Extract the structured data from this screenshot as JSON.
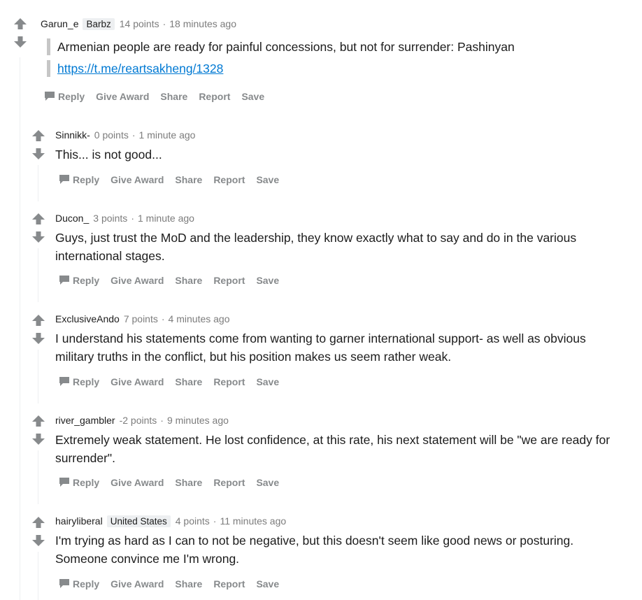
{
  "comments": [
    {
      "author": "Garun_e",
      "flair": "Barbz",
      "points": "14 points",
      "time": "18 minutes ago",
      "quote_lines": [
        "Armenian people are ready for painful concessions, but not for surrender: Pashinyan"
      ],
      "link": "https://t.me/reartsakheng/1328"
    },
    {
      "author": "Sinnikk-",
      "points": "0 points",
      "time": "1 minute ago",
      "text": "This... is not good..."
    },
    {
      "author": "Ducon_",
      "points": "3 points",
      "time": "1 minute ago",
      "text": "Guys, just trust the MoD and the leadership, they know exactly what to say and do in the various international stages."
    },
    {
      "author": "ExclusiveAndo",
      "points": "7 points",
      "time": "4 minutes ago",
      "text": "I understand his statements come from wanting to garner international support- as well as obvious military truths in the conflict, but his position makes us seem rather weak."
    },
    {
      "author": "river_gambler",
      "points": "-2 points",
      "time": "9 minutes ago",
      "text": "Extremely weak statement. He lost confidence, at this rate, his next statement will be \"we are ready for surrender\"."
    },
    {
      "author": "hairyliberal",
      "flair": "United States",
      "points": "4 points",
      "time": "11 minutes ago",
      "text": "I'm trying as hard as I can to not be negative, but this doesn't seem like good news or posturing. Someone convince me I'm wrong."
    }
  ],
  "actions": {
    "reply": "Reply",
    "award": "Give Award",
    "share": "Share",
    "report": "Report",
    "save": "Save"
  },
  "meta_separator": "·",
  "icons": {
    "upvote": "arrow-up-icon",
    "downvote": "arrow-down-icon",
    "reply": "speech-bubble-icon"
  },
  "colors": {
    "link": "#0079d3",
    "action_text": "#878a8c",
    "vote_arrow": "#878a8c",
    "flair_bg": "#edeff1"
  }
}
